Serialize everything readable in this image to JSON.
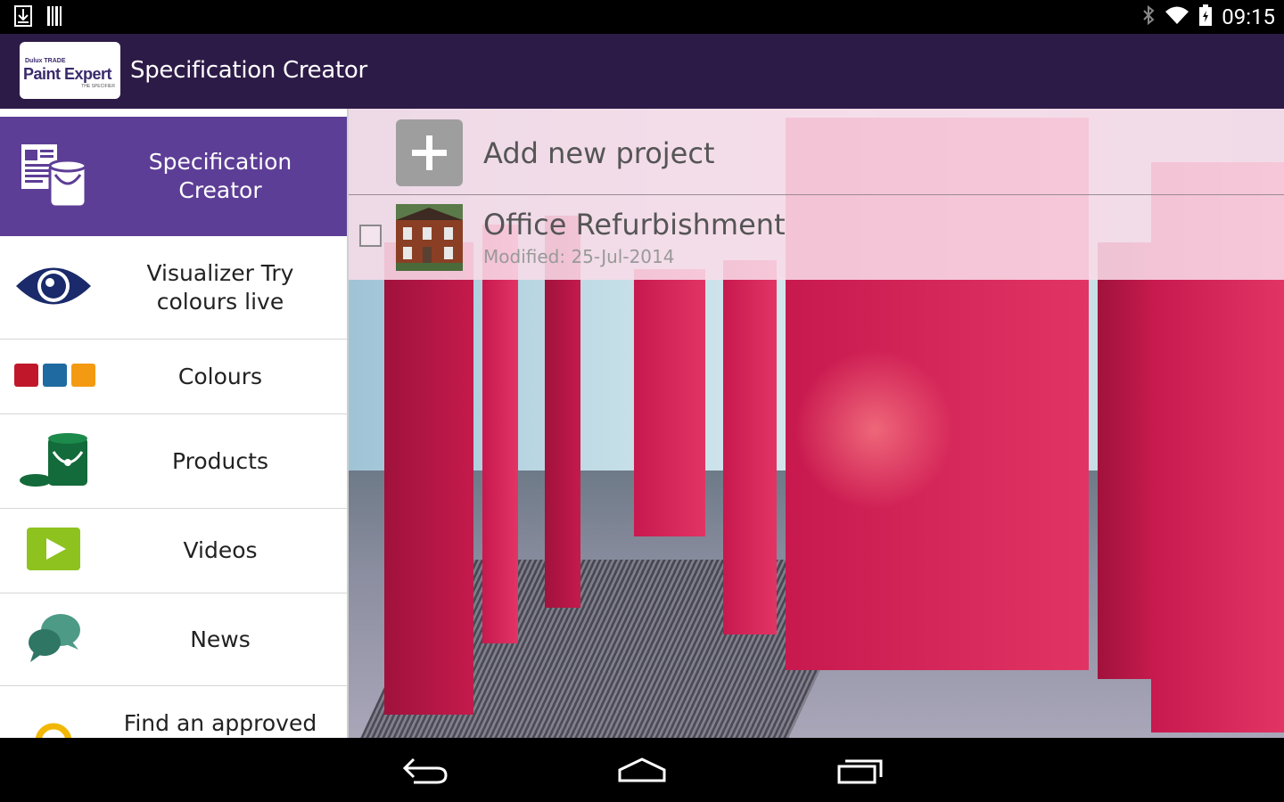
{
  "status_bar": {
    "time": "09:15"
  },
  "header": {
    "logo_brand": "Dulux TRADE",
    "logo_name": "Paint Expert",
    "logo_tagline": "THE SPECIFIER",
    "title": "Specification Creator"
  },
  "sidebar": {
    "items": [
      {
        "label": "Specification Creator",
        "icon": "spec-creator-icon",
        "active": true
      },
      {
        "label": "Visualizer Try colours live",
        "icon": "eye-icon",
        "active": false
      },
      {
        "label": "Colours",
        "icon": "colour-swatches-icon",
        "active": false
      },
      {
        "label": "Products",
        "icon": "paint-can-icon",
        "active": false
      },
      {
        "label": "Videos",
        "icon": "play-icon",
        "active": false
      },
      {
        "label": "News",
        "icon": "chat-bubbles-icon",
        "active": false
      },
      {
        "label": "Find an approved",
        "icon": "location-icon",
        "active": false
      }
    ]
  },
  "projects": {
    "add_label": "Add new project",
    "list": [
      {
        "name": "Office Refurbishment",
        "modified": "Modified: 25-Jul-2014"
      }
    ]
  },
  "colors": {
    "action_bar": "#2d1b47",
    "sidebar_active": "#5d3e96",
    "panel_pink": "#d9265a"
  }
}
